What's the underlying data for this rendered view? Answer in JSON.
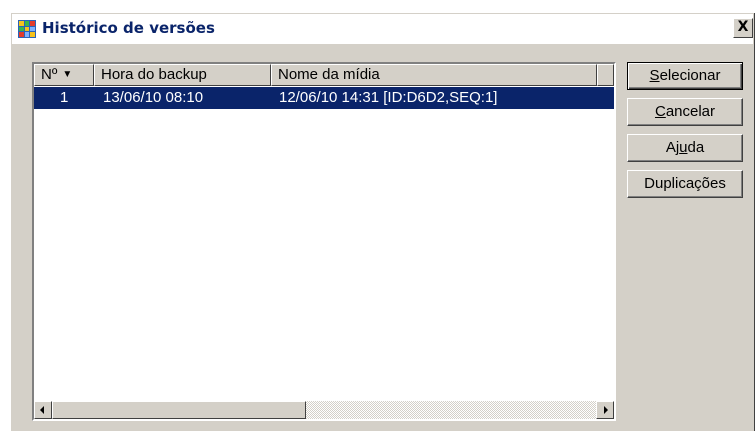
{
  "window": {
    "title": "Histórico de versões",
    "close_label": "X",
    "icon": "app-grid-icon"
  },
  "list": {
    "columns": [
      "Nº",
      "Hora do backup",
      "Nome da mídia",
      ""
    ],
    "sort_indicator": "▼",
    "rows": [
      {
        "num": "1",
        "backup_time": "13/06/10 08:10",
        "media_name": "12/06/10 14:31 [ID:D6D2,SEQ:1]",
        "selected": true
      }
    ],
    "scrollbar": {
      "left_icon": "arrow-left-icon",
      "right_icon": "arrow-right-icon"
    }
  },
  "buttons": {
    "select": {
      "pre": "",
      "accel": "S",
      "post": "elecionar"
    },
    "cancel": {
      "pre": "",
      "accel": "C",
      "post": "ancelar"
    },
    "help": {
      "pre": "Aj",
      "accel": "u",
      "post": "da"
    },
    "duplicates": {
      "pre": "Duplicações",
      "accel": "",
      "post": ""
    }
  },
  "colors": {
    "selection_bg": "#0a246a",
    "selection_fg": "#ffffff",
    "dialog_bg": "#d4d0c8",
    "title_text": "#0a246a"
  }
}
